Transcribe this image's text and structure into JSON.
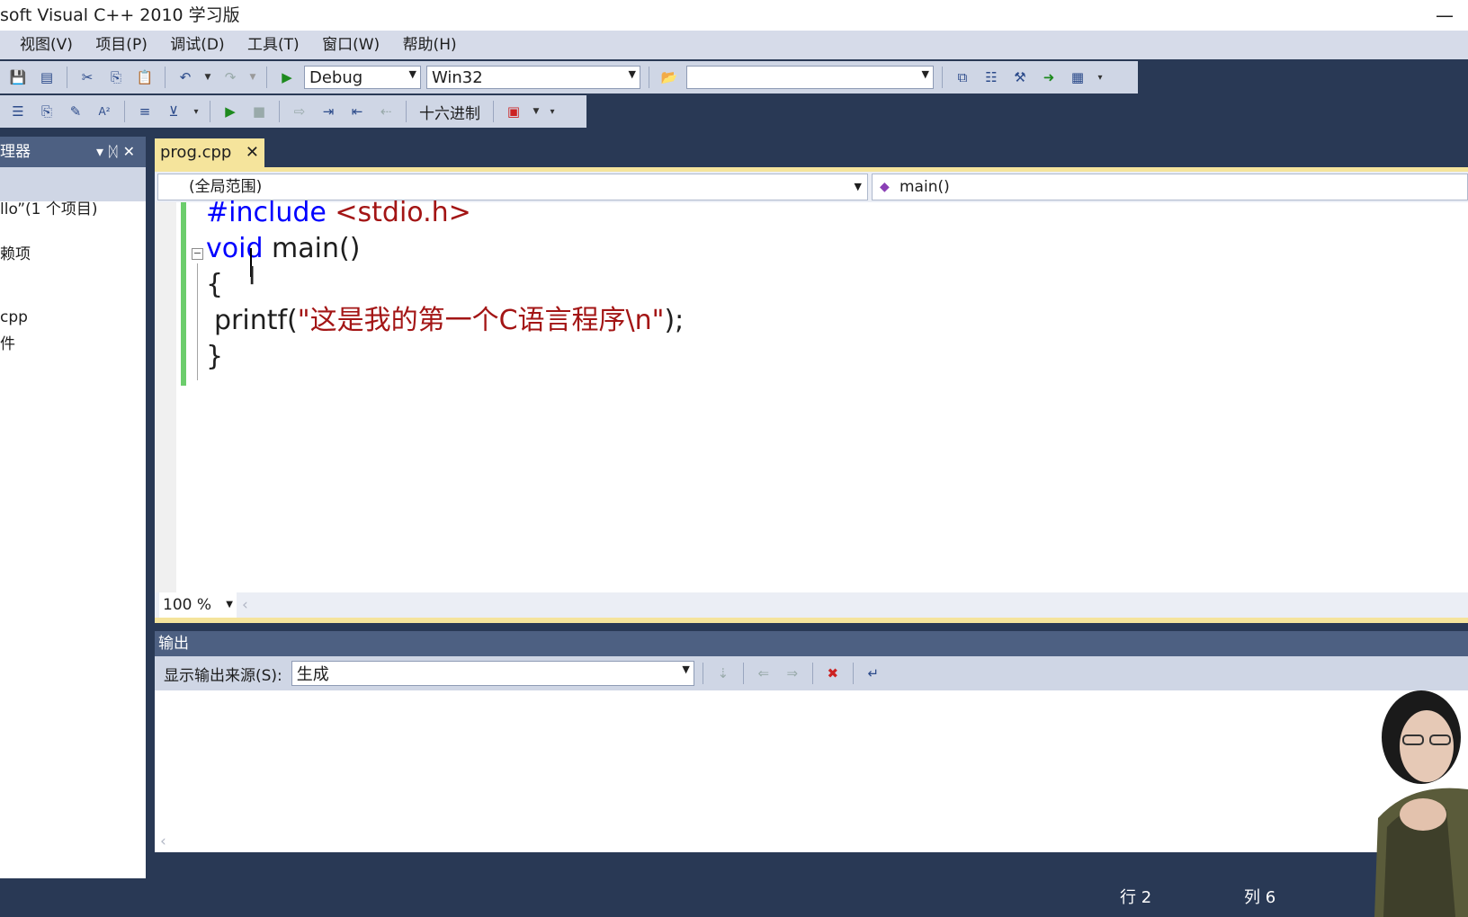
{
  "window": {
    "title": "soft Visual C++ 2010 学习版",
    "minimize": "—"
  },
  "menu": [
    "视图(V)",
    "项目(P)",
    "调试(D)",
    "工具(T)",
    "窗口(W)",
    "帮助(H)"
  ],
  "toolbar": {
    "config": "Debug",
    "platform": "Win32",
    "find_value": "",
    "hex_label": "十六进制"
  },
  "sidebar": {
    "title": "理器",
    "items": [
      "llo”(1 个项目)",
      "赖项",
      "cpp",
      "件"
    ]
  },
  "editor": {
    "tab_label": "prog.cpp",
    "scope": "(全局范围)",
    "function": "main()",
    "code": {
      "line1_kw": "#include",
      "line1_rest": "<stdio.h>",
      "line2_kw": "void",
      "line2_rest": "main()",
      "line3": "{",
      "line4_pre": "printf(",
      "line4_str": "\"这是我的第一个C语言程序\\n\"",
      "line4_post": ");",
      "line5": "}"
    },
    "zoom": "100 %"
  },
  "output": {
    "title": "输出",
    "source_label": "显示输出来源(S):",
    "source_value": "生成"
  },
  "status": {
    "line": "行 2",
    "col": "列 6"
  },
  "colors": {
    "frame": "#293955",
    "tab_active": "#f5e49c",
    "keyword": "#0000ff",
    "string": "#a31515",
    "modified_bar": "#6ccd6c"
  }
}
